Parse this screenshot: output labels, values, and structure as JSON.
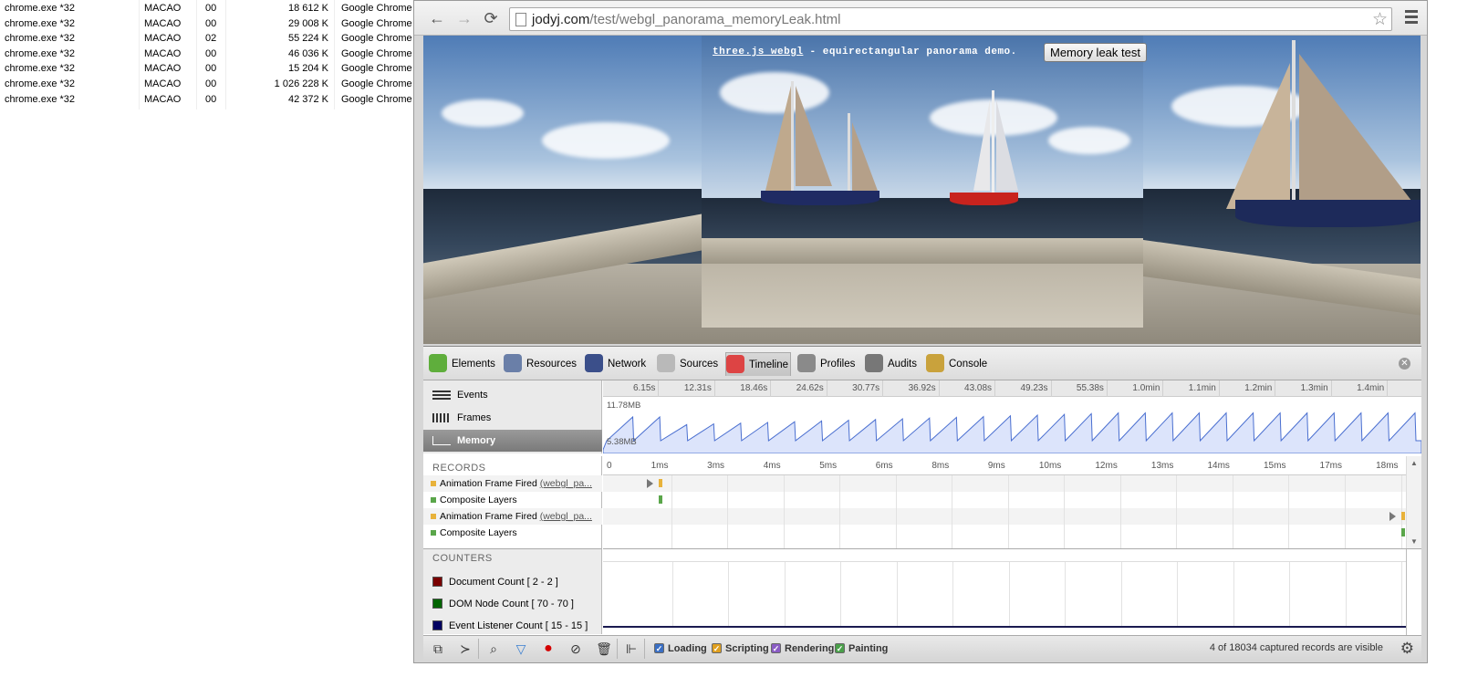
{
  "task_manager": {
    "rows": [
      {
        "name": "chrome.exe *32",
        "user": "MACAO",
        "cpu": "00",
        "memory": "18 612 K",
        "description": "Google Chrome"
      },
      {
        "name": "chrome.exe *32",
        "user": "MACAO",
        "cpu": "00",
        "memory": "29 008 K",
        "description": "Google Chrome"
      },
      {
        "name": "chrome.exe *32",
        "user": "MACAO",
        "cpu": "02",
        "memory": "55 224 K",
        "description": "Google Chrome"
      },
      {
        "name": "chrome.exe *32",
        "user": "MACAO",
        "cpu": "00",
        "memory": "46 036 K",
        "description": "Google Chrome"
      },
      {
        "name": "chrome.exe *32",
        "user": "MACAO",
        "cpu": "00",
        "memory": "15 204 K",
        "description": "Google Chrome"
      },
      {
        "name": "chrome.exe *32",
        "user": "MACAO",
        "cpu": "00",
        "memory": "1 026 228 K",
        "description": "Google Chrome"
      },
      {
        "name": "chrome.exe *32",
        "user": "MACAO",
        "cpu": "00",
        "memory": "42 372 K",
        "description": "Google Chrome"
      }
    ]
  },
  "browser": {
    "nav": {
      "back": "←",
      "forward": "→",
      "reload": "⟳"
    },
    "url_host": "jodyj.com",
    "url_path": "/test/webgl_panorama_memoryLeak.html",
    "star": "☆"
  },
  "page": {
    "title_link": "three.js webgl",
    "title_rest": " - equirectangular panorama demo.",
    "leak_button": "Memory leak test"
  },
  "devtools": {
    "tabs": [
      {
        "label": "Elements",
        "icon": "elements-icon",
        "color": "#5fae3c"
      },
      {
        "label": "Resources",
        "icon": "resources-icon",
        "color": "#6a7fa8"
      },
      {
        "label": "Network",
        "icon": "network-icon",
        "color": "#3b4f8a"
      },
      {
        "label": "Sources",
        "icon": "sources-icon",
        "color": "#b9b9b9"
      },
      {
        "label": "Timeline",
        "icon": "timeline-icon",
        "color": "#d44"
      },
      {
        "label": "Profiles",
        "icon": "profiles-icon",
        "color": "#8a8a8a"
      },
      {
        "label": "Audits",
        "icon": "audits-icon",
        "color": "#777"
      },
      {
        "label": "Console",
        "icon": "console-icon",
        "color": "#c9a23c"
      }
    ],
    "active_tab": "Timeline",
    "overview": {
      "items": [
        "Events",
        "Frames",
        "Memory"
      ],
      "selected": "Memory",
      "ticks": [
        "6.15s",
        "12.31s",
        "18.46s",
        "24.62s",
        "30.77s",
        "36.92s",
        "43.08s",
        "49.23s",
        "55.38s",
        "1.0min",
        "1.1min",
        "1.2min",
        "1.3min",
        "1.4min"
      ],
      "mem_max": "11.78MB",
      "mem_min": "5.38MB"
    },
    "records": {
      "header": "RECORDS",
      "ticks": [
        "0",
        "1ms",
        "3ms",
        "4ms",
        "5ms",
        "6ms",
        "8ms",
        "9ms",
        "10ms",
        "12ms",
        "13ms",
        "14ms",
        "15ms",
        "17ms",
        "18ms"
      ],
      "rows": [
        {
          "label": "Animation Frame Fired",
          "link": "(webgl_pa...",
          "color": "#e8b23a"
        },
        {
          "label": "Composite Layers",
          "link": "",
          "color": "#5aa64a"
        },
        {
          "label": "Animation Frame Fired",
          "link": "(webgl_pa...",
          "color": "#e8b23a"
        },
        {
          "label": "Composite Layers",
          "link": "",
          "color": "#5aa64a"
        }
      ]
    },
    "counters": {
      "header": "COUNTERS",
      "items": [
        {
          "label": "Document Count [ 2 - 2 ]",
          "color": "#7a0000"
        },
        {
          "label": "DOM Node Count [ 70 - 70 ]",
          "color": "#006400"
        },
        {
          "label": "Event Listener Count [ 15 - 15 ]",
          "color": "#000060"
        }
      ]
    },
    "status": {
      "filters": [
        {
          "label": "Loading",
          "color": "#3a6fc4"
        },
        {
          "label": "Scripting",
          "color": "#e0a020"
        },
        {
          "label": "Rendering",
          "color": "#8a5cc4"
        },
        {
          "label": "Painting",
          "color": "#4aa04a"
        }
      ],
      "text": "4 of 18034 captured records are visible"
    }
  }
}
